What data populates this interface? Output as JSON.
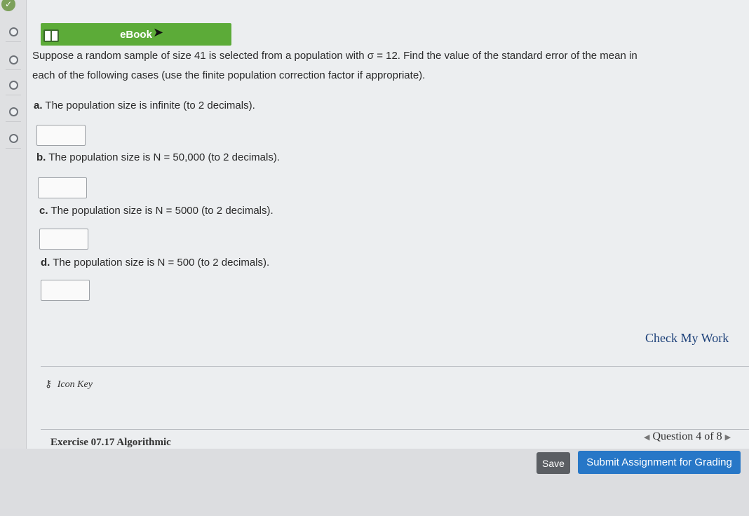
{
  "ebook": {
    "label": "eBook"
  },
  "question": {
    "prompt_line1": "Suppose a random sample of size 41 is selected from a population with σ = 12. Find the value of the standard error of the mean in",
    "prompt_line2": "each of the following cases (use the finite population correction factor if appropriate).",
    "parts": [
      {
        "letter": "a.",
        "text": "The population size is infinite (to 2 decimals)."
      },
      {
        "letter": "b.",
        "text": "The population size is N = 50,000 (to 2 decimals)."
      },
      {
        "letter": "c.",
        "text": "The population size is N = 5000 (to 2 decimals)."
      },
      {
        "letter": "d.",
        "text": "The population size is N = 500 (to 2 decimals)."
      }
    ]
  },
  "actions": {
    "check_my_work": "Check My Work",
    "icon_key": "Icon Key",
    "save": "Save",
    "submit": "Submit Assignment for Grading"
  },
  "footer": {
    "exercise": "Exercise 07.17 Algorithmic",
    "question_nav": "Question 4 of 8"
  },
  "colors": {
    "ebook_green": "#5cab38",
    "submit_blue": "#2777c7",
    "link_blue": "#1b3f78"
  }
}
